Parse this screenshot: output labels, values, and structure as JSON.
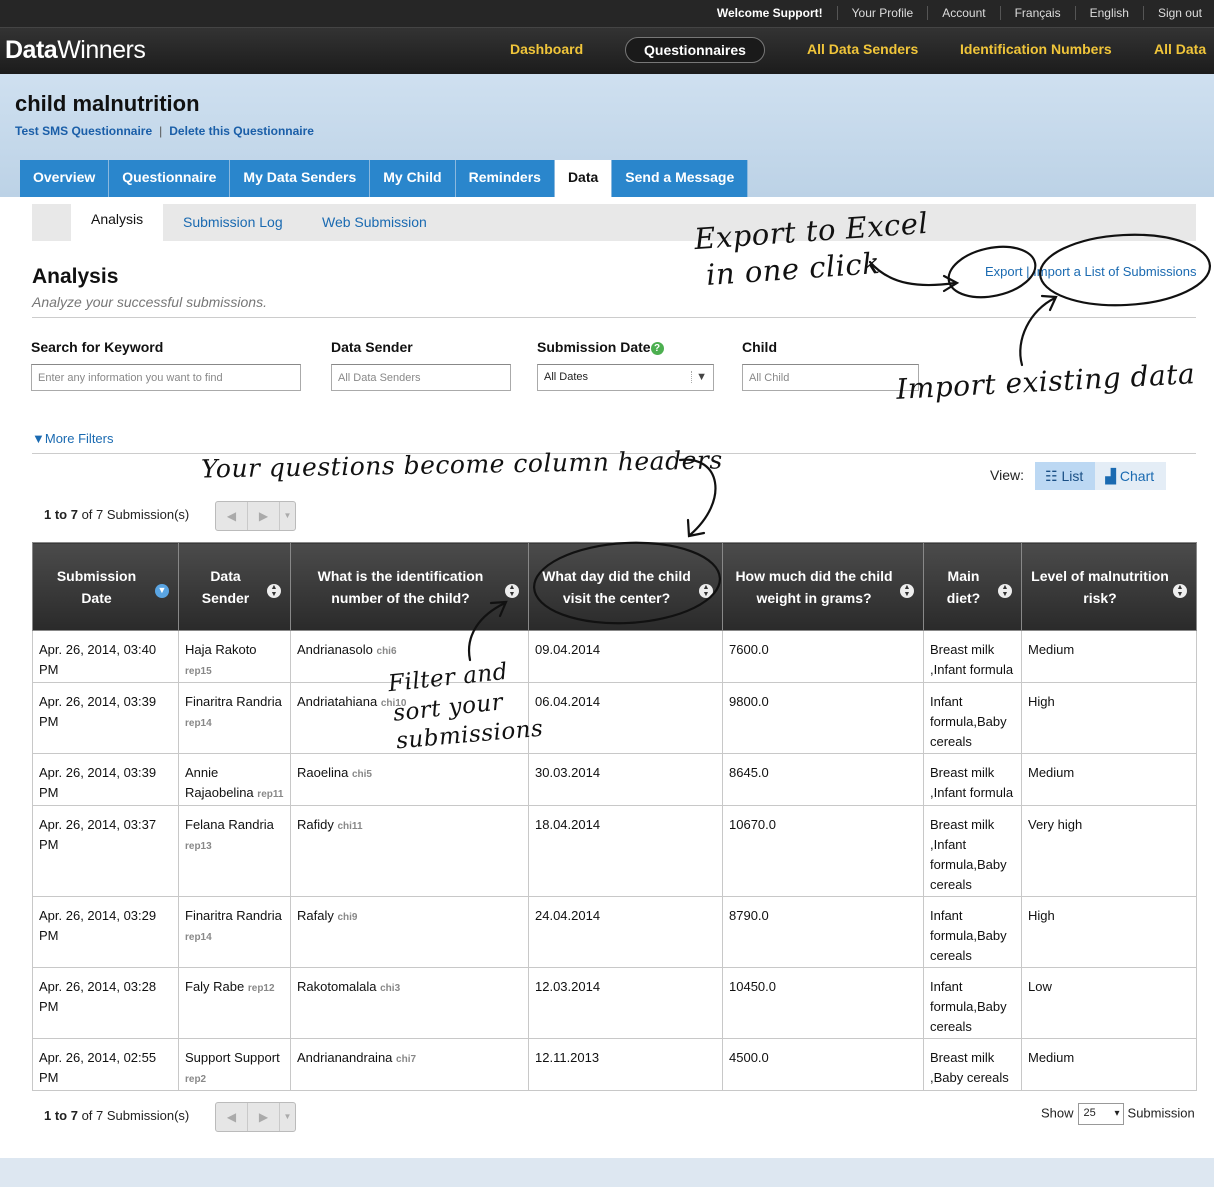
{
  "topbar": {
    "welcome": "Welcome Support!",
    "links": [
      "Your Profile",
      "Account",
      "Français",
      "English",
      "Sign out"
    ]
  },
  "brand": {
    "bold": "Data",
    "rest": "Winners"
  },
  "mainnav": [
    "Dashboard",
    "Questionnaires",
    "All Data Senders",
    "Identification Numbers",
    "All Data"
  ],
  "project": {
    "title": "child malnutrition",
    "test_sms": "Test SMS Questionnaire",
    "sep": "|",
    "delete": "Delete this Questionnaire"
  },
  "tabs": [
    "Overview",
    "Questionnaire",
    "My Data Senders",
    "My Child",
    "Reminders",
    "Data",
    "Send a Message"
  ],
  "subtabs": [
    "Analysis",
    "Submission Log",
    "Web Submission"
  ],
  "analysis": {
    "title": "Analysis",
    "subtitle": "Analyze your successful submissions.",
    "export": "Export | Import a List of Submissions"
  },
  "filters": {
    "keyword_label": "Search for Keyword",
    "keyword_placeholder": "Enter any information you want to find",
    "sender_label": "Data Sender",
    "sender_placeholder": "All Data Senders",
    "date_label": "Submission Date",
    "date_help": "?",
    "date_value": "All Dates",
    "child_label": "Child",
    "child_placeholder": "All Child",
    "more": "▼More Filters"
  },
  "view": {
    "label": "View:",
    "list": "List",
    "chart": "Chart"
  },
  "pagination": {
    "range": "1 to 7",
    "rest": " of 7 Submission(s)",
    "prev": "◀",
    "next": "▶",
    "menu": "▼"
  },
  "table": {
    "headers": [
      "Submission Date",
      "Data Sender",
      "What is the identification number of the child?",
      "What day did the child visit the center?",
      "How much did the child weight in grams?",
      "Main diet?",
      "Level of malnutrition risk?"
    ],
    "rows": [
      {
        "date": "Apr. 26, 2014, 03:40 PM",
        "sender": "Haja Rakoto",
        "sender_id": "rep15",
        "child": "Andrianasolo",
        "child_id": "chi6",
        "visit": "09.04.2014",
        "weight": "7600.0",
        "diet": "Breast milk ,Infant formula",
        "risk": "Medium"
      },
      {
        "date": "Apr. 26, 2014, 03:39 PM",
        "sender": "Finaritra Randria",
        "sender_id": "rep14",
        "child": "Andriatahiana",
        "child_id": "chi10",
        "visit": "06.04.2014",
        "weight": "9800.0",
        "diet": "Infant formula,Baby cereals",
        "risk": "High"
      },
      {
        "date": "Apr. 26, 2014, 03:39 PM",
        "sender": "Annie Rajaobelina",
        "sender_id": "rep11",
        "child": "Raoelina",
        "child_id": "chi5",
        "visit": "30.03.2014",
        "weight": "8645.0",
        "diet": "Breast milk ,Infant formula",
        "risk": "Medium"
      },
      {
        "date": "Apr. 26, 2014, 03:37 PM",
        "sender": "Felana Randria",
        "sender_id": "rep13",
        "child": "Rafidy",
        "child_id": "chi11",
        "visit": "18.04.2014",
        "weight": "10670.0",
        "diet": "Breast milk ,Infant formula,Baby cereals",
        "risk": "Very high"
      },
      {
        "date": "Apr. 26, 2014, 03:29 PM",
        "sender": "Finaritra Randria",
        "sender_id": "rep14",
        "child": "Rafaly",
        "child_id": "chi9",
        "visit": "24.04.2014",
        "weight": "8790.0",
        "diet": "Infant formula,Baby cereals",
        "risk": "High"
      },
      {
        "date": "Apr. 26, 2014, 03:28 PM",
        "sender": "Faly Rabe",
        "sender_id": "rep12",
        "child": "Rakotomalala",
        "child_id": "chi3",
        "visit": "12.03.2014",
        "weight": "10450.0",
        "diet": "Infant formula,Baby cereals",
        "risk": "Low"
      },
      {
        "date": "Apr. 26, 2014, 02:55 PM",
        "sender": "Support Support",
        "sender_id": "rep2",
        "child": "Andrianandraina",
        "child_id": "chi7",
        "visit": "12.11.2013",
        "weight": "4500.0",
        "diet": "Breast milk ,Baby cereals",
        "risk": "Medium"
      }
    ]
  },
  "show": {
    "label": "Show",
    "value": "25",
    "suffix": "Submission"
  },
  "annotations": {
    "export_excel_1": "Export to Excel",
    "export_excel_2": "in one click",
    "import_data": "Import existing data",
    "questions_headers": "Your questions become column headers",
    "filter_sort_1": "Filter and",
    "filter_sort_2": "sort your",
    "filter_sort_3": "submissions"
  },
  "colors": {
    "accent": "#2a86cc",
    "nav_gold": "#f0c53a",
    "link": "#1a6ab1"
  }
}
